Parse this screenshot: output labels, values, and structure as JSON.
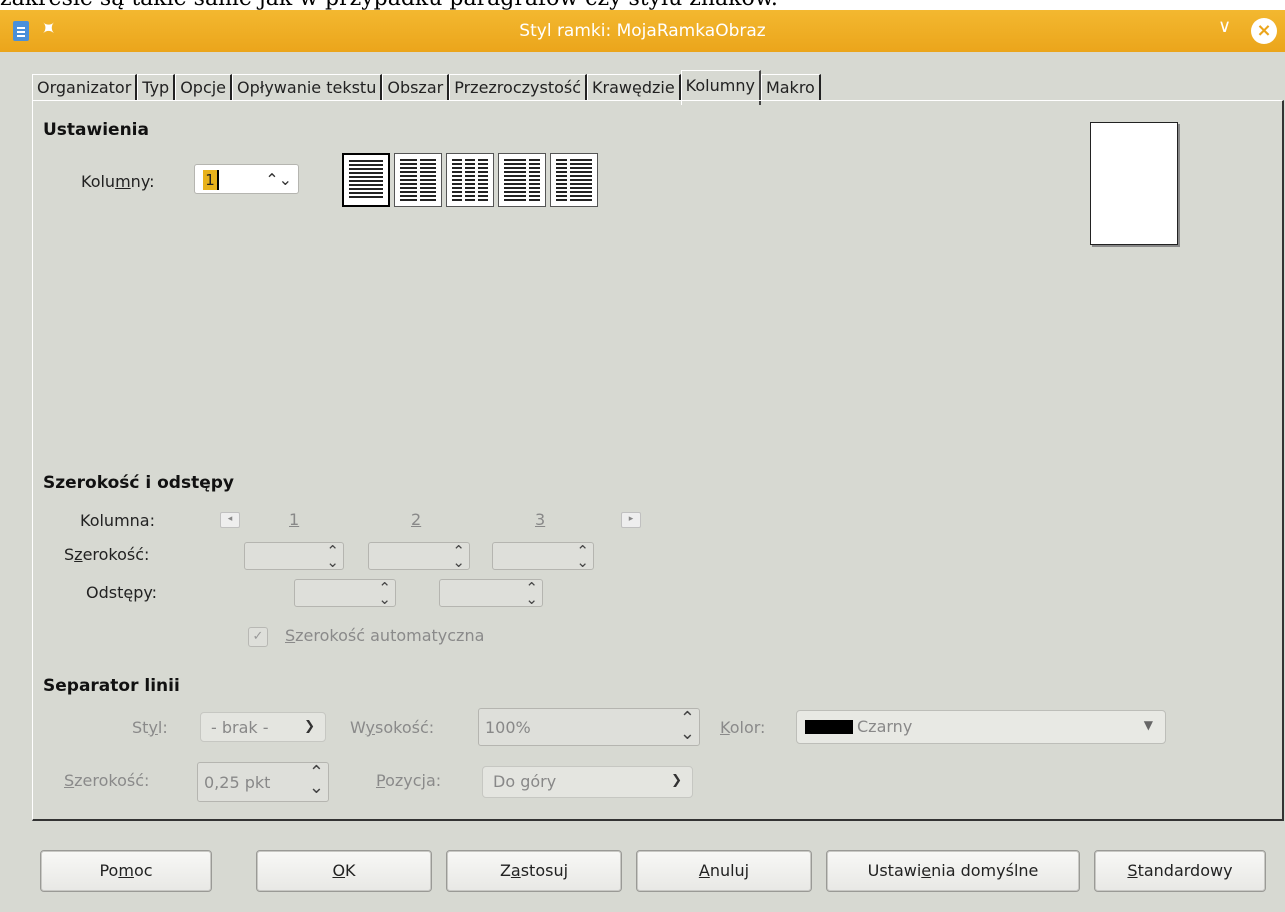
{
  "background_text": "zakresie są takie same jak w przypadku paragrafów czy stylu znaków.",
  "window": {
    "title": "Styl ramki: MojaRamkaObraz"
  },
  "tabs": [
    "Organizator",
    "Typ",
    "Opcje",
    "Opływanie tekstu",
    "Obszar",
    "Przezroczystość",
    "Krawędzie",
    "Kolumny",
    "Makro"
  ],
  "active_tab": "Kolumny",
  "settings": {
    "heading": "Ustawienia",
    "columns_label_pre": "Kolu",
    "columns_label_u": "m",
    "columns_label_post": "ny:",
    "columns_value": "1"
  },
  "width_spacing": {
    "heading": "Szerokość i odstępy",
    "column_label": "Kolumna:",
    "col_numbers": [
      "1",
      "2",
      "3"
    ],
    "width_label_pre": "S",
    "width_label_u": "z",
    "width_label_post": "erokość:",
    "spacing_label": "Odstępy:",
    "auto_width_u": "S",
    "auto_width_rest": "zerokość automatyczna"
  },
  "separator": {
    "heading": "Separator linii",
    "style_label_pre": "St",
    "style_label_u": "y",
    "style_label_post": "l:",
    "style_value": "- brak -",
    "height_label_pre": "W",
    "height_label_u": "y",
    "height_label_post": "sokość:",
    "height_value": "100%",
    "color_label_u": "K",
    "color_label_post": "olor:",
    "color_value": "Czarny",
    "width_label_u": "S",
    "width_label_post": "zerokość:",
    "width_value": "0,25 pkt",
    "position_label_u": "P",
    "position_label_post": "ozycja:",
    "position_value": "Do góry"
  },
  "buttons": {
    "help_pre": "Po",
    "help_u": "m",
    "help_post": "oc",
    "ok_u": "O",
    "ok_post": "K",
    "apply_pre": "Z",
    "apply_u": "a",
    "apply_post": "stosuj",
    "cancel_u": "A",
    "cancel_post": "nuluj",
    "defaults_pre": "Ustawi",
    "defaults_u": "e",
    "defaults_post": "nia domyślne",
    "standard_u": "S",
    "standard_post": "tandardowy"
  },
  "colors": {
    "titlebar": "#eba51b",
    "dialog_bg": "#d7d9d2",
    "accent": "#e8b21c"
  }
}
